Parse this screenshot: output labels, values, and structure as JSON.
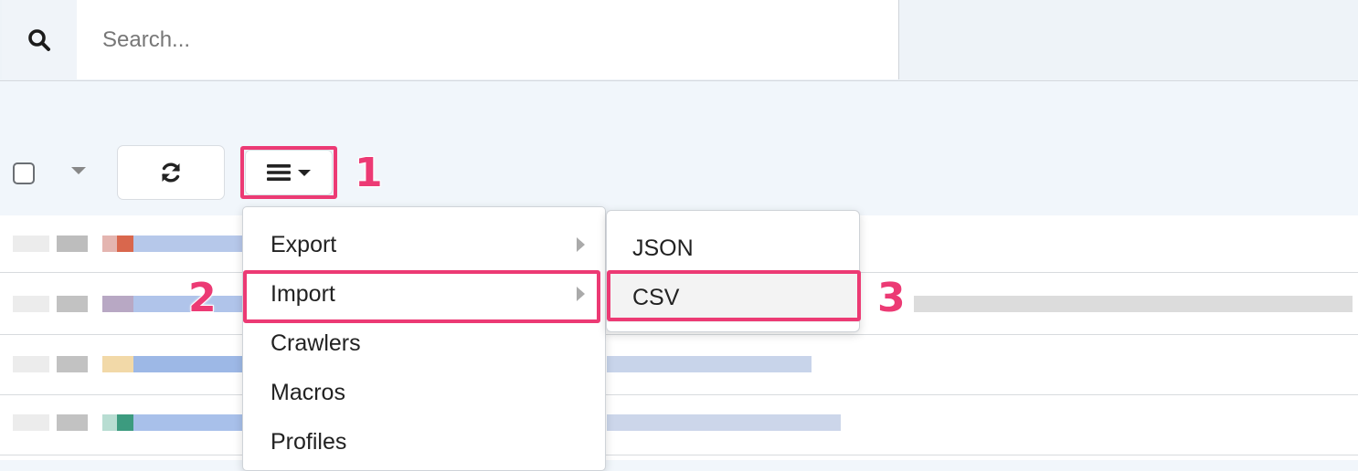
{
  "search": {
    "placeholder": "Search...",
    "icon": "search-icon"
  },
  "toolbar": {
    "select_all_icon": "checkbox",
    "select_caret_icon": "caret-down-icon",
    "refresh_icon": "refresh-icon",
    "menu_icon": "hamburger-icon"
  },
  "dropdown": {
    "items": [
      {
        "label": "Export",
        "has_submenu": true
      },
      {
        "label": "Import",
        "has_submenu": true
      },
      {
        "label": "Crawlers",
        "has_submenu": false
      },
      {
        "label": "Macros",
        "has_submenu": false
      },
      {
        "label": "Profiles",
        "has_submenu": false
      }
    ]
  },
  "submenu": {
    "items": [
      {
        "label": "JSON"
      },
      {
        "label": "CSV"
      }
    ]
  },
  "annotations": {
    "step1": "1",
    "step2": "2",
    "step3": "3",
    "color": "#ec3a74"
  }
}
